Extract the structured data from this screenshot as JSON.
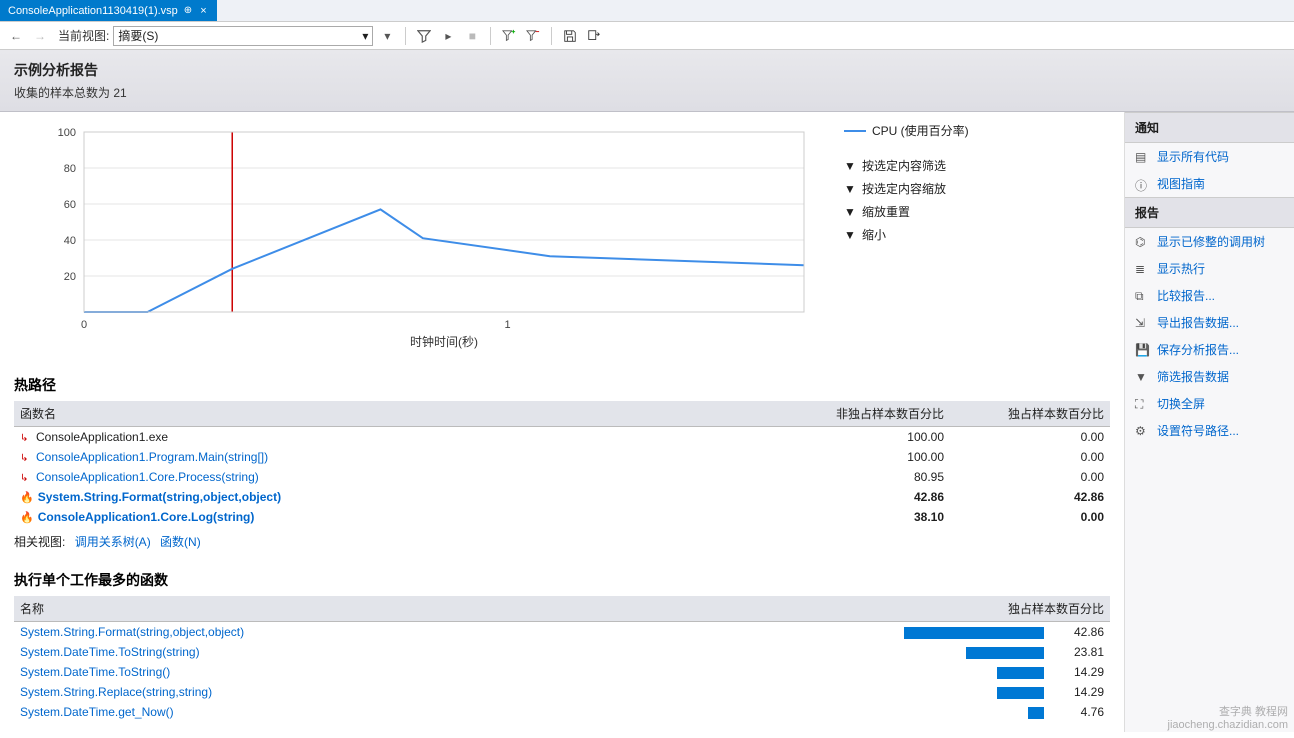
{
  "tab": {
    "filename": "ConsoleApplication1130419(1).vsp"
  },
  "toolbar": {
    "view_label": "当前视图:",
    "view_value": "摘要(S)"
  },
  "header": {
    "title": "示例分析报告",
    "subtitle": "收集的样本总数为 21"
  },
  "chart_data": {
    "type": "line",
    "title": "",
    "xlabel": "时钟时间(秒)",
    "ylabel": "",
    "xlim": [
      0,
      1.7
    ],
    "ylim": [
      0,
      100
    ],
    "yticks": [
      20,
      40,
      60,
      80,
      100
    ],
    "xticks": [
      0,
      1
    ],
    "series": [
      {
        "name": "CPU (使用百分率)",
        "color": "#3e8de8",
        "x": [
          0.0,
          0.15,
          0.35,
          0.7,
          0.8,
          1.1,
          1.7
        ],
        "y": [
          0,
          0,
          24,
          57,
          41,
          31,
          26
        ]
      }
    ],
    "marker_x": 0.35
  },
  "chart_controls": {
    "filter_by_selection": "按选定内容筛选",
    "zoom_by_selection": "按选定内容缩放",
    "reset_zoom": "缩放重置",
    "zoom_out": "缩小"
  },
  "hotpath": {
    "title": "热路径",
    "cols": {
      "name": "函数名",
      "inclusive": "非独占样本数百分比",
      "exclusive": "独占样本数百分比"
    },
    "rows": [
      {
        "indent": 0,
        "icon": "branch",
        "name": "ConsoleApplication1.exe",
        "inc": "100.00",
        "exc": "0.00",
        "link": false,
        "bold": false
      },
      {
        "indent": 1,
        "icon": "branch",
        "name": "ConsoleApplication1.Program.Main(string[])",
        "inc": "100.00",
        "exc": "0.00",
        "link": true,
        "bold": false
      },
      {
        "indent": 2,
        "icon": "branch",
        "name": "ConsoleApplication1.Core.Process(string)",
        "inc": "80.95",
        "exc": "0.00",
        "link": true,
        "bold": false
      },
      {
        "indent": 3,
        "icon": "flame",
        "name": "System.String.Format(string,object,object)",
        "inc": "42.86",
        "exc": "42.86",
        "link": true,
        "bold": true
      },
      {
        "indent": 3,
        "icon": "flame",
        "name": "ConsoleApplication1.Core.Log(string)",
        "inc": "38.10",
        "exc": "0.00",
        "link": true,
        "bold": true
      }
    ],
    "related_label": "相关视图:",
    "related_links": [
      "调用关系树(A)",
      "函数(N)"
    ]
  },
  "topfuncs": {
    "title": "执行单个工作最多的函数",
    "cols": {
      "name": "名称",
      "exclusive": "独占样本数百分比"
    },
    "rows": [
      {
        "name": "System.String.Format(string,object,object)",
        "pct": 42.86
      },
      {
        "name": "System.DateTime.ToString(string)",
        "pct": 23.81
      },
      {
        "name": "System.DateTime.ToString()",
        "pct": 14.29
      },
      {
        "name": "System.String.Replace(string,string)",
        "pct": 14.29
      },
      {
        "name": "System.DateTime.get_Now()",
        "pct": 4.76
      }
    ]
  },
  "side": {
    "notify_h": "通知",
    "notify": [
      {
        "icon": "code",
        "label": "显示所有代码"
      },
      {
        "icon": "info",
        "label": "视图指南"
      }
    ],
    "report_h": "报告",
    "report": [
      {
        "icon": "tree",
        "label": "显示已修整的调用树"
      },
      {
        "icon": "lines",
        "label": "显示热行"
      },
      {
        "icon": "compare",
        "label": "比较报告..."
      },
      {
        "icon": "export",
        "label": "导出报告数据..."
      },
      {
        "icon": "save",
        "label": "保存分析报告..."
      },
      {
        "icon": "filter",
        "label": "筛选报告数据"
      },
      {
        "icon": "fullscreen",
        "label": "切换全屏"
      },
      {
        "icon": "symbols",
        "label": "设置符号路径..."
      }
    ]
  },
  "watermark": {
    "l1": "查字典 教程网",
    "l2": "jiaocheng.chazidian.com"
  }
}
